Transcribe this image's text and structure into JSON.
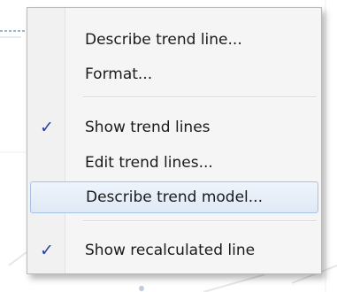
{
  "menu": {
    "items": [
      {
        "label": "Describe trend line...",
        "checked": false,
        "highlighted": false
      },
      {
        "label": "Format...",
        "checked": false,
        "highlighted": false
      },
      {
        "label": "Show trend lines",
        "checked": true,
        "highlighted": false
      },
      {
        "label": "Edit trend lines...",
        "checked": false,
        "highlighted": false
      },
      {
        "label": "Describe trend model...",
        "checked": false,
        "highlighted": true
      },
      {
        "label": "Show recalculated line",
        "checked": true,
        "highlighted": false
      }
    ],
    "check_glyph": "✓",
    "colors": {
      "check": "#2743a8",
      "highlight_border": "#a6c3e6",
      "menu_bg": "#f5f5f5"
    }
  }
}
